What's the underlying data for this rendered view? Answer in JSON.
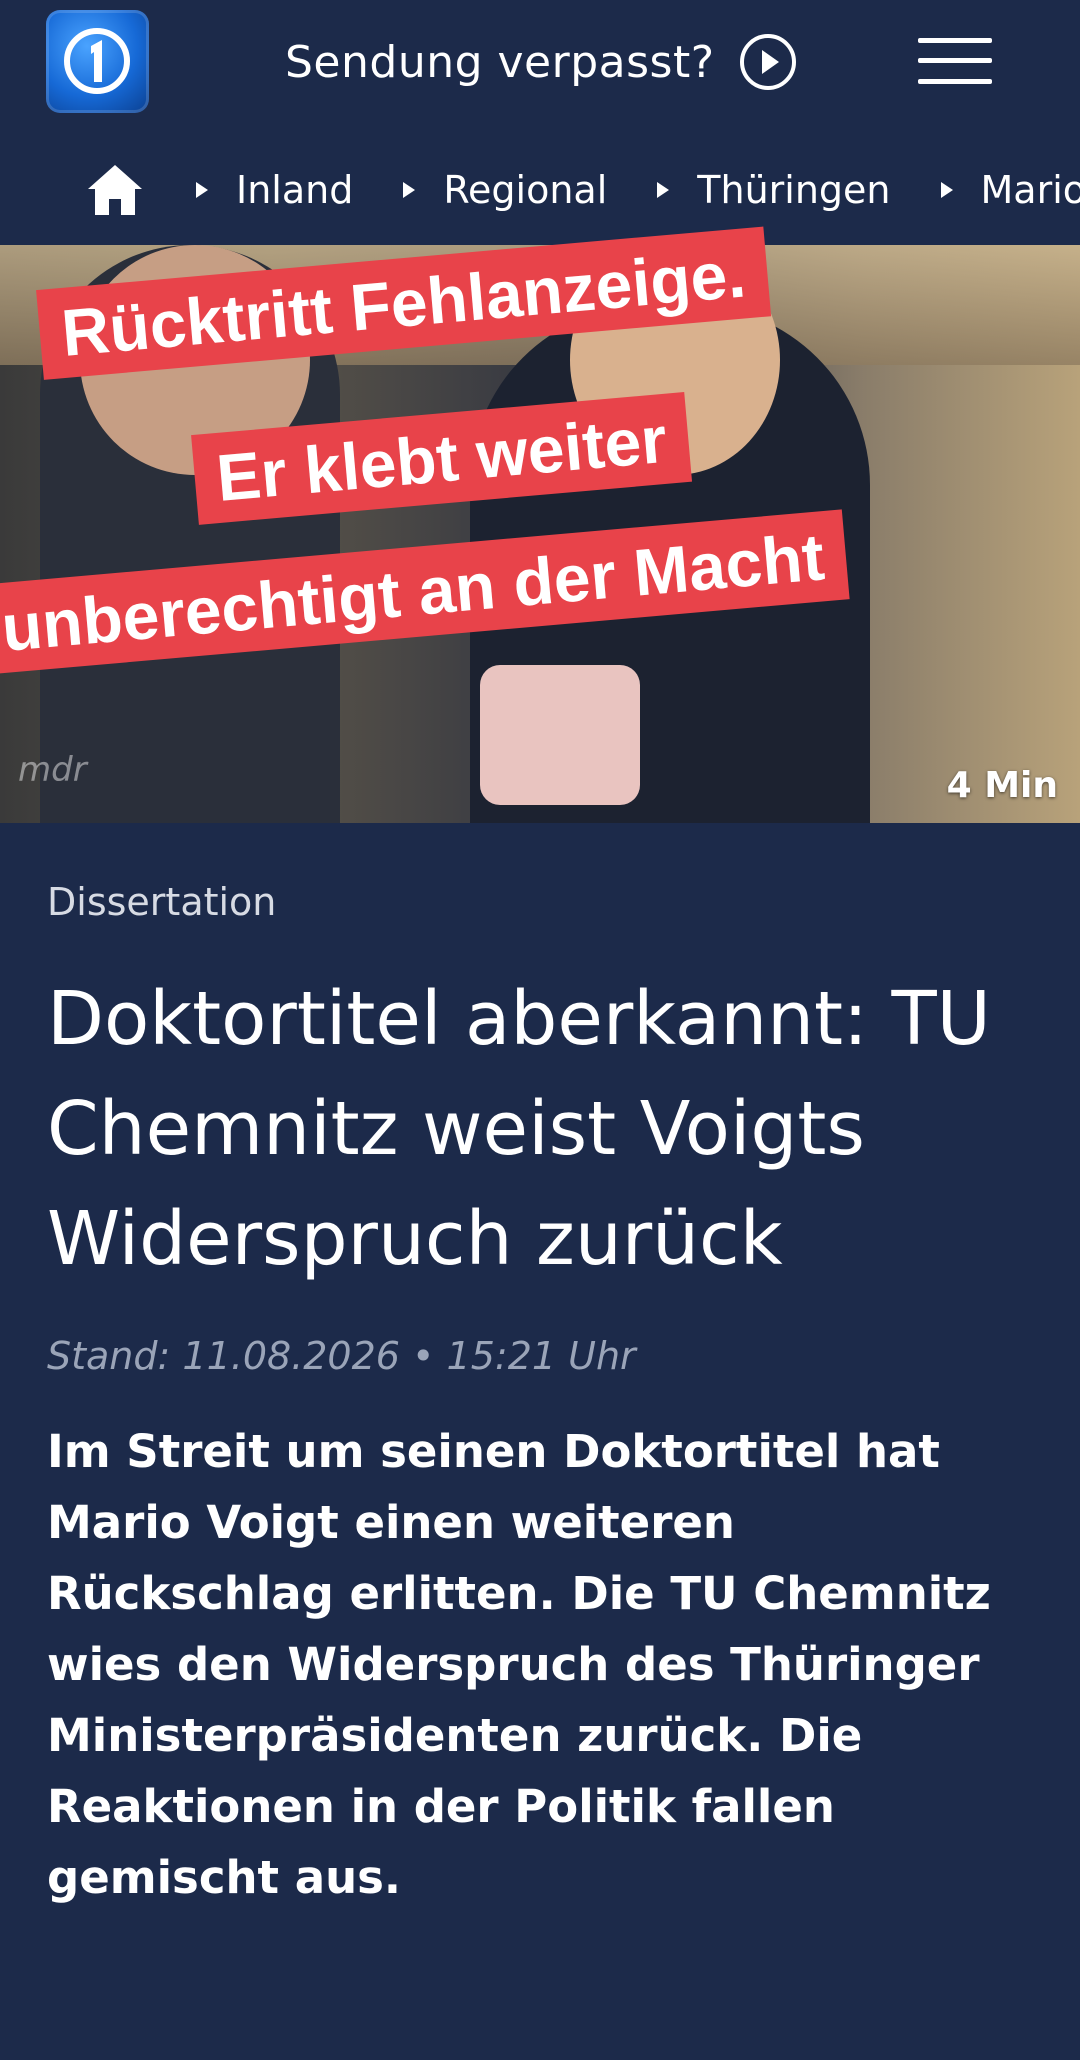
{
  "header": {
    "logo": "tagesschau-logo",
    "missed_label": "Sendung verpasst?",
    "play_icon": "play-circle-icon",
    "menu_icon": "hamburger-menu-icon"
  },
  "breadcrumb": {
    "home_icon": "home-icon",
    "items": [
      {
        "label": "Inland"
      },
      {
        "label": "Regional"
      },
      {
        "label": "Thüringen"
      },
      {
        "label": "Mario V"
      }
    ]
  },
  "hero": {
    "watermark": "mdr",
    "duration": "4 Min",
    "caption_lines": [
      "Rücktritt Fehlanzeige.",
      "Er klebt weiter",
      "unberechtigt an der Macht"
    ],
    "caption_color": "#e8434a"
  },
  "article": {
    "topline": "Dissertation",
    "headline": "Doktortitel aberkannt: TU Chemnitz weist Voigts Widerspruch zurück",
    "meta": "Stand: 11.08.2026 • 15:21 Uhr",
    "teaser": "Im Streit um seinen Doktortitel hat Mario Voigt einen weiteren Rückschlag erlitten. Die TU Chemnitz wies den Widerspruch des Thüringer Ministerpräsidenten zurück. Die Reaktionen in der Politik fallen gemischt aus."
  },
  "colors": {
    "background": "#1c2a4a",
    "logo_blue": "#1669d6"
  }
}
